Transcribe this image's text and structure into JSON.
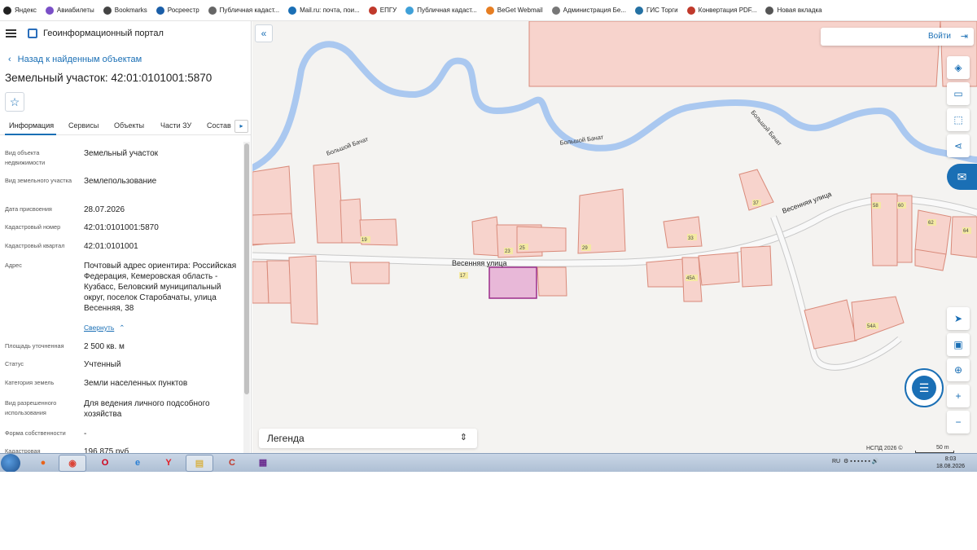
{
  "bookmarks": [
    {
      "label": "Яндекс",
      "color": "#222"
    },
    {
      "label": "Авиабилеты",
      "color": "#7a4fc7"
    },
    {
      "label": "Bookmarks",
      "color": "#444"
    },
    {
      "label": "Росреестр",
      "color": "#1a5ea8"
    },
    {
      "label": "Публичная кадаст...",
      "color": "#666"
    },
    {
      "label": "Mail.ru: почта, пои...",
      "color": "#1a6fb5"
    },
    {
      "label": "ЕПГУ",
      "color": "#c0392b"
    },
    {
      "label": "Публичная кадаст...",
      "color": "#3fa0d8"
    },
    {
      "label": "BeGet Webmail",
      "color": "#e67e22"
    },
    {
      "label": "Администрация Бе...",
      "color": "#777"
    },
    {
      "label": "ГИС Торги",
      "color": "#2471a3"
    },
    {
      "label": "Конвертация PDF...",
      "color": "#c0392b"
    },
    {
      "label": "Новая вкладка",
      "color": "#555"
    }
  ],
  "header": {
    "portal_title": "Геоинформационный портал"
  },
  "back_link": "Назад к найденным объектам",
  "parcel_title": "Земельный участок: 42:01:0101001:5870",
  "tabs": [
    "Информация",
    "Сервисы",
    "Объекты",
    "Части ЗУ",
    "Состав"
  ],
  "info": {
    "type_label": "Вид объекта недвижимости",
    "type_value": "Земельный участок",
    "kind_label": "Вид земельного участка",
    "kind_value": "Землепользование",
    "date_label": "Дата присвоения",
    "date_value": "28.07.2026",
    "cadnum_label": "Кадастровый номер",
    "cadnum_value": "42:01:0101001:5870",
    "quarter_label": "Кадастровый квартал",
    "quarter_value": "42:01:0101001",
    "address_label": "Адрес",
    "address_value": "Почтовый адрес ориентира: Российская Федерация, Кемеровская область - Кузбасс, Беловский муниципальный округ, поселок Старобачаты, улица Весенняя, 38",
    "collapse": "Свернуть",
    "area_label": "Площадь уточненная",
    "area_value": "2 500 кв. м",
    "status_label": "Статус",
    "status_value": "Учтенный",
    "category_label": "Категория земель",
    "category_value": "Земли населенных пунктов",
    "use_label": "Вид разрешенного использования",
    "use_value": "Для ведения личного подсобного хозяйства",
    "ownership_label": "Форма собственности",
    "ownership_value": "-",
    "cost_label": "Кадастровая",
    "cost_value": "196 875 руб"
  },
  "map": {
    "login": "Войти",
    "legend": "Легенда",
    "attribution": "НСПД 2026 ©",
    "scale": "50 m",
    "river_labels": [
      "Большой Бачат",
      "Большой Бачат",
      "Большой Бачат"
    ],
    "street_labels": [
      "Весенняя улица",
      "Весенняя улица"
    ],
    "house_numbers": [
      "19",
      "23",
      "25",
      "29",
      "33",
      "37",
      "58",
      "60",
      "62",
      "64",
      "17",
      "45А",
      "54А"
    ],
    "colors": {
      "parcel_fill": "#f7d3cc",
      "parcel_stroke": "#d98a7a",
      "river": "#aac8f0",
      "selected_fill": "#e8b8d8",
      "selected_stroke": "#9b2d8a",
      "accent": "#1a6fb5"
    }
  },
  "taskbar": {
    "lang": "RU",
    "time": "8:03",
    "date": "18.08.2026",
    "apps": [
      "Firefox",
      "Chrome",
      "Opera",
      "Internet Explorer",
      "Yandex",
      "Explorer",
      "CCleaner",
      "WinRAR"
    ]
  }
}
